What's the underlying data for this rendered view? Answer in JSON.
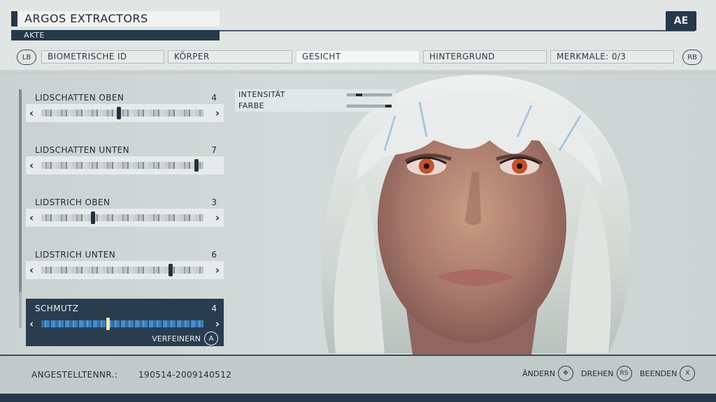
{
  "header": {
    "title": "ARGOS EXTRACTORS",
    "subtitle": "AKTE",
    "logo": "AE"
  },
  "tabs": {
    "left_button": "LB",
    "right_button": "RB",
    "items": [
      {
        "label": "BIOMETRISCHE ID",
        "active": false
      },
      {
        "label": "KÖRPER",
        "active": false
      },
      {
        "label": "GESICHT",
        "active": true
      },
      {
        "label": "HINTERGRUND",
        "active": false
      },
      {
        "label": "MERKMALE: 0/3",
        "active": false
      }
    ]
  },
  "sliders": [
    {
      "label": "LIDSCHATTEN OBEN",
      "value": "4"
    },
    {
      "label": "LIDSCHATTEN UNTEN",
      "value": "7"
    },
    {
      "label": "LIDSTRICH OBEN",
      "value": "3"
    },
    {
      "label": "LIDSTRICH UNTEN",
      "value": "6"
    },
    {
      "label": "SCHMUTZ",
      "value": "4",
      "selected": true,
      "refine_label": "VERFEINERN",
      "refine_button": "A"
    }
  ],
  "options_panel": {
    "intensity_label": "INTENSITÄT",
    "color_label": "FARBE"
  },
  "footer": {
    "employee_label": "ANGESTELLTENNR.:",
    "employee_value": "190514-2009140512",
    "actions": [
      {
        "label": "ÄNDERN",
        "button": "✥"
      },
      {
        "label": "DREHEN",
        "button": "RS"
      },
      {
        "label": "BEENDEN",
        "button": "X"
      }
    ]
  },
  "colors": {
    "accent_dark": "#26394a",
    "selected_track": "#2f6fa8",
    "background": "#d9dedd"
  }
}
